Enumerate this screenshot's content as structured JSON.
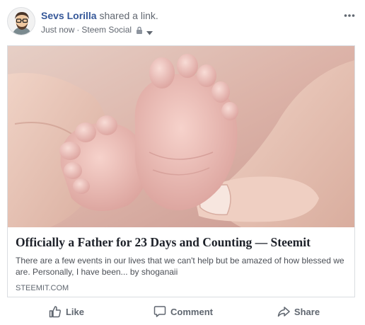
{
  "post": {
    "author": "Sevs Lorilla",
    "action_text": "shared a link.",
    "time": "Just now",
    "separator": "·",
    "group": "Steem Social",
    "privacy_icon": "lock-icon",
    "more_icon": "ellipsis-icon"
  },
  "link_card": {
    "title": "Officially a Father for 23 Days and Counting — Steemit",
    "description": "There are a few events in our lives that we can't help but be amazed of how blessed we are. Personally, I have been... by shoganaii",
    "domain": "STEEMIT.COM",
    "image_subject": "baby-feet-in-hands"
  },
  "actions": [
    {
      "label": "Like",
      "icon": "thumbs-up-icon"
    },
    {
      "label": "Comment",
      "icon": "comment-icon"
    },
    {
      "label": "Share",
      "icon": "share-icon"
    }
  ],
  "colors": {
    "author_link": "#365899",
    "secondary_text": "#616770",
    "title_text": "#1d2129",
    "border": "#dadde1"
  }
}
